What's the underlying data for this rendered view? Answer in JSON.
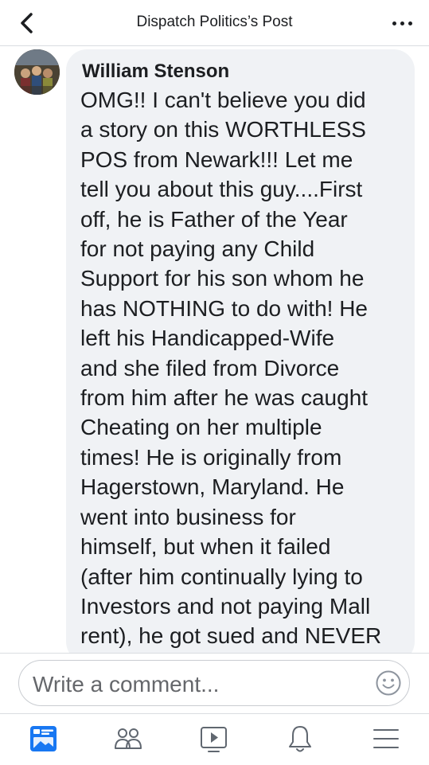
{
  "header": {
    "title": "Dispatch Politics’s Post",
    "back_icon": "chevron-left-icon",
    "more_icon": "more-horizontal-icon"
  },
  "comment": {
    "author": "William Stenson",
    "text": "OMG!! I can't believe you did\na story on this WORTHLESS\nPOS from Newark!!! Let me\ntell you about this guy....First\noff, he is Father of the Year\nfor not paying any Child\nSupport for his son whom he\nhas NOTHING to do with! He\nleft his Handicapped-Wife\nand she filed from Divorce\nfrom him after he was caught\nCheating on her multiple\ntimes! He is originally from\nHagerstown, Maryland. He\nwent into business for\nhimself, but when it failed\n(after him continually lying to\nInvestors and not paying Mall\nrent), he got sued and NEVER"
  },
  "composer": {
    "placeholder": "Write a comment...",
    "emoji_icon": "smiley-icon"
  },
  "tabbar": {
    "tabs": [
      {
        "icon": "news-feed-icon",
        "active": true
      },
      {
        "icon": "friends-icon",
        "active": false
      },
      {
        "icon": "watch-icon",
        "active": false
      },
      {
        "icon": "notifications-bell-icon",
        "active": false
      },
      {
        "icon": "menu-icon",
        "active": false
      }
    ]
  },
  "colors": {
    "accent": "#1877f2",
    "bubble": "#f0f2f5",
    "text": "#1c1e21",
    "muted": "#65676b"
  }
}
